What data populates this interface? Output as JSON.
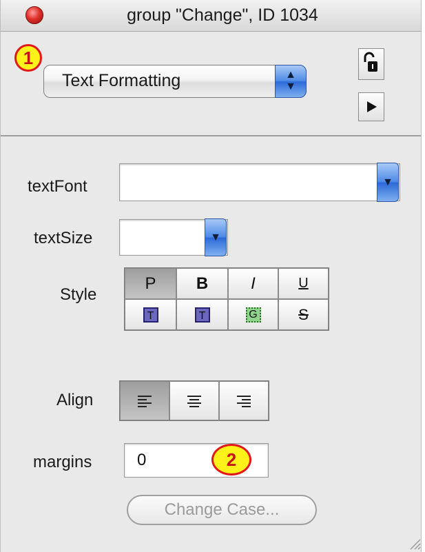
{
  "window": {
    "title": "group \"Change\", ID 1034"
  },
  "top": {
    "popup_label": "Text Formatting",
    "popup_arrows": "▲▼",
    "badge1": "1",
    "lock_icon": "lock-open-icon",
    "play_icon": "play-icon"
  },
  "fields": {
    "textFont": {
      "label": "textFont",
      "value": ""
    },
    "textSize": {
      "label": "textSize",
      "value": ""
    },
    "style": {
      "label": "Style",
      "row1": [
        "P",
        "B",
        "I",
        "U"
      ],
      "row2": [
        "T",
        "T",
        "G",
        "S"
      ]
    },
    "align": {
      "label": "Align",
      "options": [
        "left",
        "center",
        "right"
      ],
      "selected": "left"
    },
    "margins": {
      "label": "margins",
      "value": "0"
    },
    "badge2": "2"
  },
  "buttons": {
    "change_case": "Change Case..."
  }
}
